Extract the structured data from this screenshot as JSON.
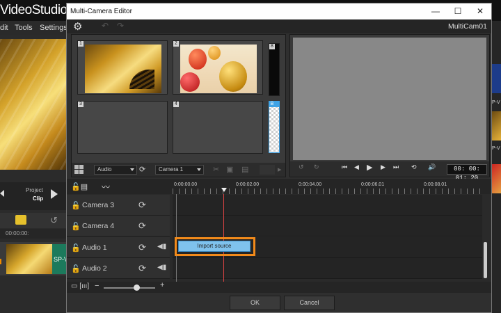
{
  "background_app": {
    "title": "VideoStudio X",
    "menu": [
      "dit",
      "Tools",
      "Settings"
    ],
    "project_label": "Project",
    "clip_label": "Clip",
    "ruler_time": "00:00:00:",
    "clip_name": "SP-V",
    "right_labels": [
      "P-V",
      "P-V"
    ]
  },
  "dialog": {
    "title": "Multi-Camera Editor",
    "window_buttons": {
      "minimize": "—",
      "maximize": "☐",
      "close": "✕"
    },
    "project_name": "MultiCam01",
    "camera_slots": [
      {
        "number": "1"
      },
      {
        "number": "2"
      },
      {
        "number": "3"
      },
      {
        "number": "4"
      },
      {
        "number": "8"
      },
      {
        "number": "B"
      }
    ],
    "toolbar": {
      "audio_dropdown": "Audio",
      "camera_dropdown": "Camera 1"
    },
    "preview": {
      "timecode": "00: 00: 01: 20"
    },
    "timeline": {
      "ruler": [
        "0:00:00.00",
        "0:00:02.00",
        "0:00:04.00",
        "0:00:06.01",
        "0:00:08.01"
      ],
      "tracks": [
        {
          "name": "Camera 3",
          "type": "video"
        },
        {
          "name": "Camera 4",
          "type": "video"
        },
        {
          "name": "Audio 1",
          "type": "audio"
        },
        {
          "name": "Audio 2",
          "type": "audio"
        }
      ],
      "import_button": "Import source"
    },
    "buttons": {
      "ok": "OK",
      "cancel": "Cancel"
    }
  },
  "colors": {
    "accent_highlight": "#f28a1a",
    "import_button": "#7fc2ed",
    "playhead": "#dd4444",
    "selected_slot": "#3fa3e6"
  }
}
